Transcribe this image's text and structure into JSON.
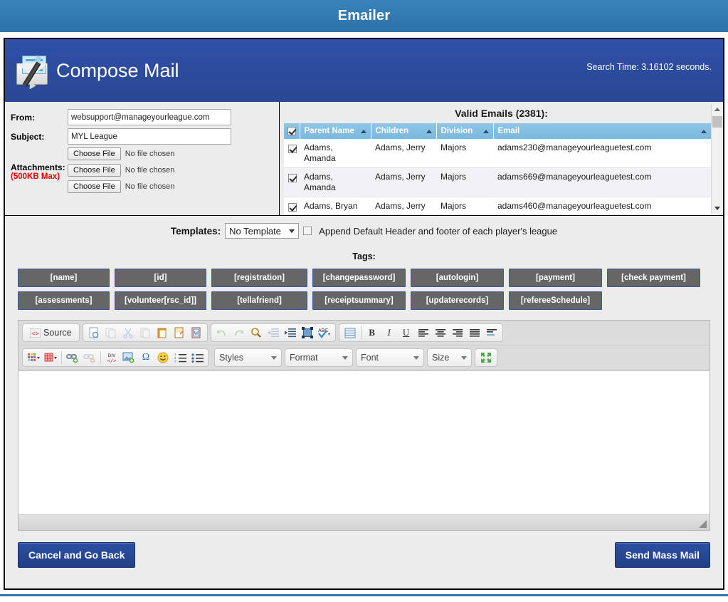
{
  "banner": {
    "title": "Emailer"
  },
  "header": {
    "title": "Compose Mail",
    "search_time": "Search Time: 3.16102 seconds.",
    "icon": "compose-mail-envelope-icon"
  },
  "form": {
    "from_label": "From:",
    "from_value": "websupport@manageyourleague.com",
    "subject_label": "Subject:",
    "subject_value": "MYL League",
    "attachments_label": "Attachments:",
    "attachments_note": "(500KB Max)",
    "choose_file_label": "Choose File",
    "no_file_label": "No file chosen",
    "file_rows": 3
  },
  "valid_emails": {
    "title": "Valid Emails (2381):",
    "columns": [
      {
        "label": "Parent Name",
        "sort": "asc"
      },
      {
        "label": "Children",
        "sort": "asc"
      },
      {
        "label": "Division",
        "sort": "asc"
      },
      {
        "label": "Email",
        "sort": "asc"
      }
    ],
    "header_checkbox_checked": true,
    "rows": [
      {
        "checked": true,
        "parent": "Adams, Amanda",
        "children": "Adams, Jerry",
        "division": "Majors",
        "email": "adams230@manageyourleaguetest.com"
      },
      {
        "checked": true,
        "parent": "Adams, Amanda",
        "children": "Adams, Jerry",
        "division": "Majors",
        "email": "adams669@manageyourleaguetest.com"
      },
      {
        "checked": true,
        "parent": "Adams, Bryan",
        "children": "Adams, Jerry",
        "division": "Majors",
        "email": "adams460@manageyourleaguetest.com"
      }
    ]
  },
  "templates": {
    "label": "Templates:",
    "selected": "No Template",
    "options": [
      "No Template"
    ],
    "append_label": "Append Default Header and footer of each player's league",
    "append_checked": false
  },
  "tags": {
    "label": "Tags:",
    "rows": [
      [
        "[name]",
        "[id]",
        "[registration]",
        "[changepassword]",
        "[autologin]",
        "[payment]",
        "[check payment]"
      ],
      [
        "[assessments]",
        "[volunteer[rsc_id]]",
        "[tellafriend]",
        "[receiptsummary]",
        "[updaterecords]",
        "[refereeSchedule]"
      ]
    ]
  },
  "editor": {
    "source_label": "Source",
    "toolbar_row1": [
      "source-icon",
      "templates-doc-icon",
      "new-page-icon",
      "cut-icon",
      "copy-icon",
      "paste-icon",
      "paste-text-icon",
      "paste-word-icon",
      "undo-icon",
      "redo-icon",
      "find-icon",
      "outdent-icon",
      "indent-icon",
      "select-all-icon",
      "spellcheck-icon"
    ],
    "toolbar_row1b": [
      "show-blocks-icon",
      "bold-icon",
      "italic-icon",
      "underline-icon",
      "align-left-icon",
      "align-center-icon",
      "align-right-icon",
      "align-justify-icon",
      "blockquote-icon"
    ],
    "toolbar_row2": [
      "text-color-icon",
      "bg-color-icon",
      "link-icon",
      "unlink-icon",
      "div-container-icon",
      "image-icon",
      "special-char-icon",
      "smiley-icon",
      "numbered-list-icon",
      "bulleted-list-icon"
    ],
    "dropdowns": [
      "Styles",
      "Format",
      "Font",
      "Size"
    ],
    "maximize_icon": "maximize-icon",
    "content": ""
  },
  "footer": {
    "cancel_label": "Cancel and Go Back",
    "send_label": "Send Mass Mail"
  },
  "colors": {
    "banner_blue": "#2f77b0",
    "header_blue": "#2a4793",
    "grid_header_blue": "#79b8df",
    "tag_gray": "#666666",
    "tag_border_blue": "#3b5a9b",
    "attach_red": "#e00000",
    "button_blue": "#223f86"
  }
}
